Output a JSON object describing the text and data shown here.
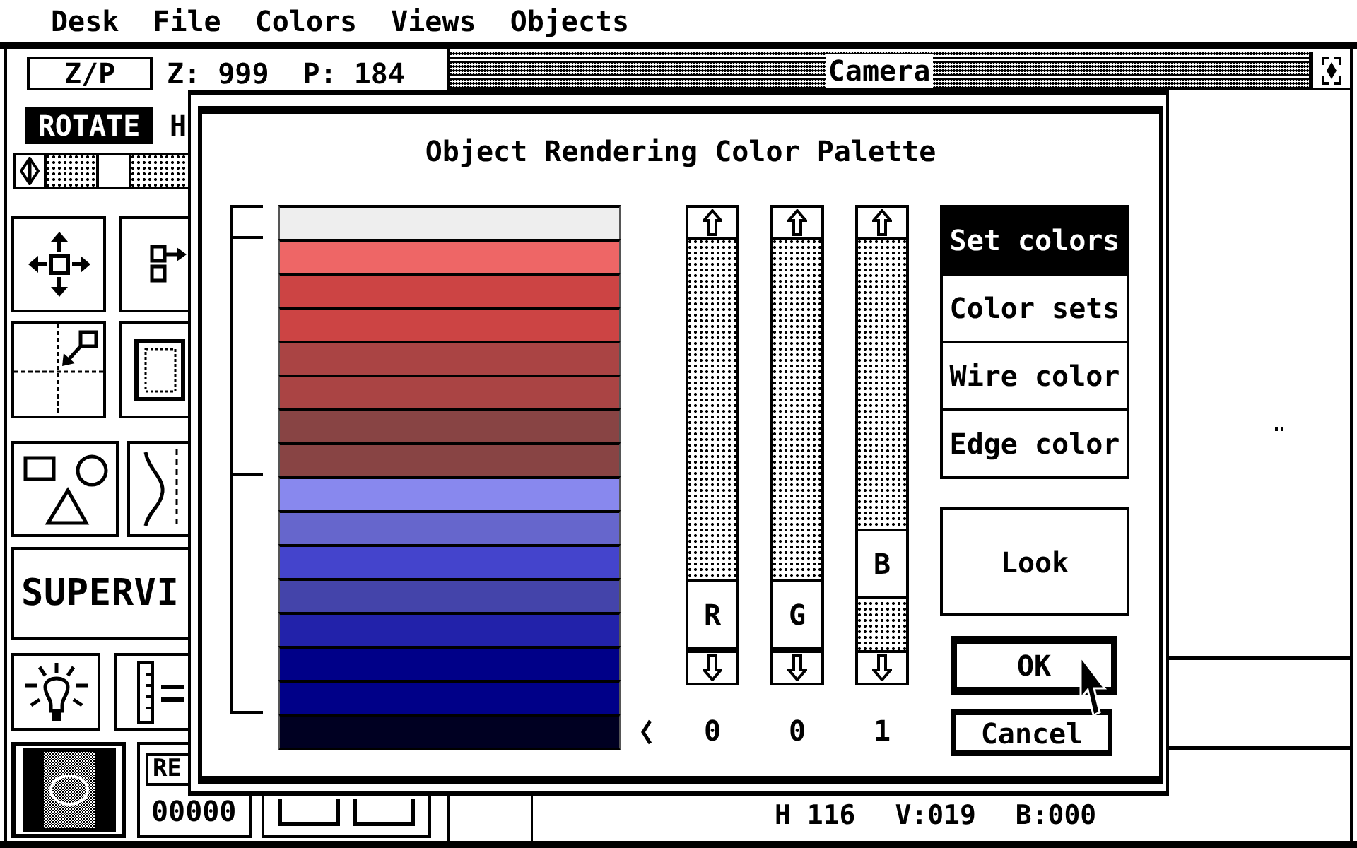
{
  "menu_bar": {
    "items": [
      "Desk",
      "File",
      "Colors",
      "Views",
      "Objects"
    ]
  },
  "tool_panel": {
    "zp_button": "Z/P",
    "zoom_reading": "Z: 999",
    "perspective_reading": "P: 184",
    "rotate_button": {
      "label": "ROTATE",
      "selected": true
    },
    "option_label": "H",
    "slider": {
      "level": 0.45
    },
    "superview_button": "SUPERVI",
    "record_panel": {
      "label": "RE",
      "counter": "00000"
    }
  },
  "camera_window": {
    "title": "Camera",
    "status": [
      "H 116",
      "V:019",
      "B:000"
    ]
  },
  "palette_dialog": {
    "title": "Object Rendering Color Palette",
    "groups": [
      {
        "bracketed": true,
        "swatches": [
          {
            "color": "#eeeeee",
            "selected": false
          }
        ]
      },
      {
        "bracketed": true,
        "swatches": [
          {
            "color": "#ee6666",
            "selected": false
          },
          {
            "color": "#cc4444",
            "selected": false
          },
          {
            "color": "#cc4444",
            "selected": false
          },
          {
            "color": "#aa4444",
            "selected": false
          },
          {
            "color": "#aa4444",
            "selected": false
          },
          {
            "color": "#884444",
            "selected": false
          },
          {
            "color": "#884444",
            "selected": false
          }
        ]
      },
      {
        "bracketed": true,
        "swatches": [
          {
            "color": "#8888ee",
            "selected": false
          },
          {
            "color": "#6666cc",
            "selected": false
          },
          {
            "color": "#4444cc",
            "selected": false
          },
          {
            "color": "#4444aa",
            "selected": false
          },
          {
            "color": "#2222aa",
            "selected": false
          },
          {
            "color": "#000088",
            "selected": false
          },
          {
            "color": "#000088",
            "selected": false
          }
        ]
      },
      {
        "bracketed": false,
        "swatches": [
          {
            "color": "#000022",
            "selected": true
          }
        ]
      }
    ],
    "channels": [
      {
        "label": "R",
        "level": 0,
        "value": "0"
      },
      {
        "label": "G",
        "level": 0,
        "value": "0"
      },
      {
        "label": "B",
        "level": 0.15,
        "value": "1"
      }
    ],
    "modes": [
      {
        "label": "Set colors",
        "selected": true
      },
      {
        "label": "Color sets",
        "selected": false
      },
      {
        "label": "Wire color",
        "selected": false
      },
      {
        "label": "Edge color",
        "selected": false
      }
    ],
    "buttons": [
      {
        "label": "Look",
        "kind": "plain"
      },
      {
        "label": "OK",
        "kind": "default"
      },
      {
        "label": "Cancel",
        "kind": "exit"
      }
    ]
  }
}
